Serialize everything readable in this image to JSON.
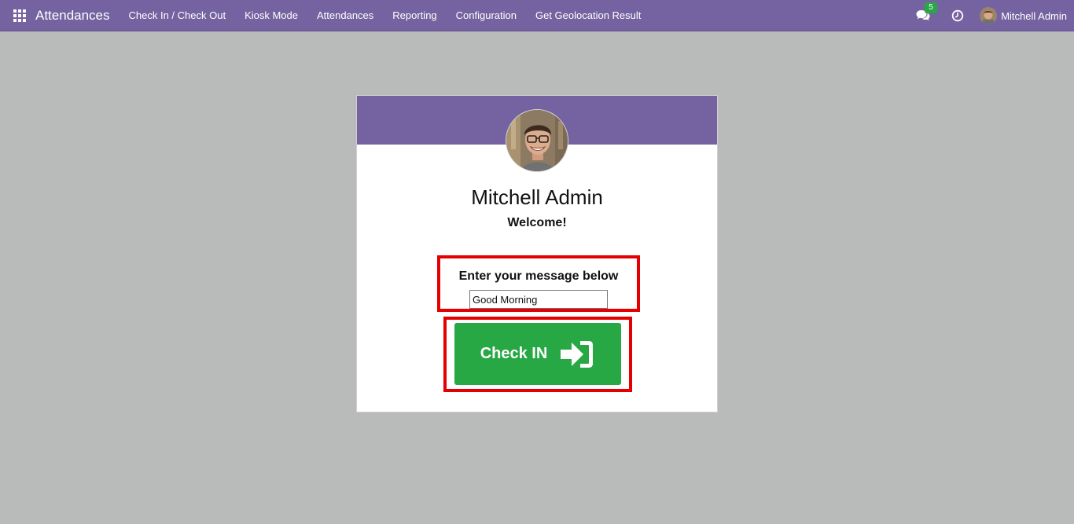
{
  "navbar": {
    "app_title": "Attendances",
    "menu": [
      {
        "label": "Check In / Check Out"
      },
      {
        "label": "Kiosk Mode"
      },
      {
        "label": "Attendances"
      },
      {
        "label": "Reporting"
      },
      {
        "label": "Configuration"
      },
      {
        "label": "Get Geolocation Result"
      }
    ],
    "messages_count": "5",
    "user_name": "Mitchell Admin",
    "colors": {
      "bar": "#7463a0",
      "badge": "#28a745"
    }
  },
  "card": {
    "employee_name": "Mitchell Admin",
    "welcome": "Welcome!",
    "message_label": "Enter your message below",
    "message_value": "Good Morning",
    "check_in_label": "Check IN",
    "colors": {
      "button": "#28a745",
      "highlight": "#e40000"
    }
  },
  "icons": [
    "apps-grid-icon",
    "chat-icon",
    "clock-icon",
    "sign-in-icon"
  ]
}
